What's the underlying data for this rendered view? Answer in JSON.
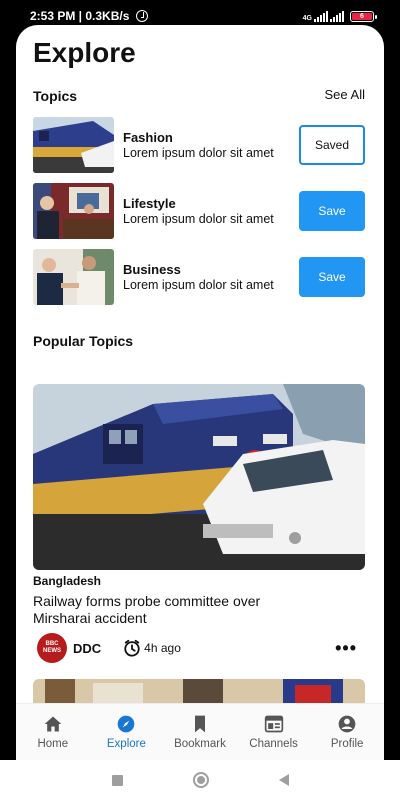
{
  "status_bar": {
    "time_speed": "2:53 PM | 0.3KB/s",
    "network": "4G",
    "battery": "6"
  },
  "page": {
    "title": "Explore"
  },
  "topics_section": {
    "title": "Topics",
    "see_all": "See All",
    "items": [
      {
        "name": "Fashion",
        "description": "Lorem ipsum dolor sit amet",
        "button": "Saved",
        "saved": true
      },
      {
        "name": "Lifestyle",
        "description": "Lorem ipsum dolor sit amet",
        "button": "Save",
        "saved": false
      },
      {
        "name": "Business",
        "description": "Lorem ipsum dolor sit amet",
        "button": "Save",
        "saved": false
      }
    ]
  },
  "popular_section": {
    "title": "Popular Topics",
    "article": {
      "category": "Bangladesh",
      "headline": "Railway forms probe committee over Mirsharai accident",
      "source": "DDC",
      "source_logo": [
        "BBC",
        "NEWS"
      ],
      "time": "4h ago"
    }
  },
  "bottom_nav": {
    "items": [
      {
        "label": "Home",
        "icon": "home-icon",
        "active": false
      },
      {
        "label": "Explore",
        "icon": "compass-icon",
        "active": true
      },
      {
        "label": "Bookmark",
        "icon": "bookmark-icon",
        "active": false
      },
      {
        "label": "Channels",
        "icon": "channels-icon",
        "active": false
      },
      {
        "label": "Profile",
        "icon": "profile-icon",
        "active": false
      }
    ]
  },
  "colors": {
    "accent": "#2196f3",
    "active_nav": "#1976d2"
  }
}
